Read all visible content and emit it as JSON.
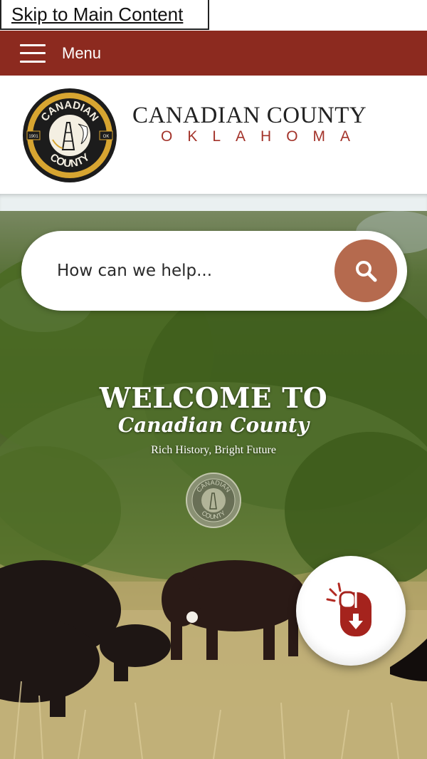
{
  "skip_link": {
    "label": "Skip to Main Content"
  },
  "menu_bar": {
    "label": "Menu",
    "background_color": "#8c2a1f"
  },
  "header": {
    "title": "CANADIAN COUNTY",
    "subtitle": "OKLAHOMA",
    "seal": {
      "top_text": "CANADIAN",
      "bottom_text": "COUNTY",
      "left_tag": "1901",
      "right_tag": "OK"
    }
  },
  "search": {
    "placeholder": "How can we help...",
    "value": "",
    "button_icon": "search-icon",
    "button_color": "#b56a4e"
  },
  "hero": {
    "welcome_line1": "WELCOME TO",
    "welcome_line2": "Canadian County",
    "tagline": "Rich History, Bright Future",
    "scroll_button_icon": "mouse-scroll-down-icon"
  }
}
